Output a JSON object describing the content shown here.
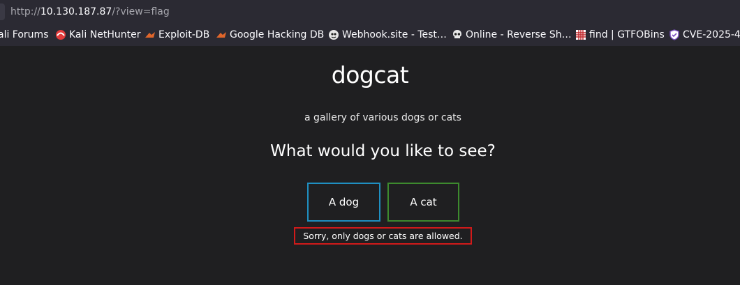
{
  "browser": {
    "url": {
      "scheme": "http://",
      "host": "10.130.187.87",
      "path": "/?view=flag"
    },
    "bookmarks": [
      {
        "label": "ali Forums",
        "icon": "kali-forums-icon"
      },
      {
        "label": "Kali NetHunter",
        "icon": "nethunter-icon"
      },
      {
        "label": "Exploit-DB",
        "icon": "exploit-db-icon"
      },
      {
        "label": "Google Hacking DB",
        "icon": "ghdb-icon"
      },
      {
        "label": "Webhook.site - Test…",
        "icon": "webhook-icon"
      },
      {
        "label": "Online - Reverse Sh…",
        "icon": "skull-icon"
      },
      {
        "label": "find | GTFOBins",
        "icon": "gtfobins-icon"
      },
      {
        "label": "CVE-2025-4",
        "icon": "cve-shield-icon"
      }
    ]
  },
  "page": {
    "title": "dogcat",
    "subtitle": "a gallery of various dogs or cats",
    "question": "What would you like to see?",
    "buttons": {
      "dog": "A dog",
      "cat": "A cat"
    },
    "error": "Sorry, only dogs or cats are allowed."
  },
  "colors": {
    "background": "#1f1f21",
    "dog_border": "#1f8fc1",
    "cat_border": "#3d8a2e",
    "error_border": "#d11a1a"
  }
}
